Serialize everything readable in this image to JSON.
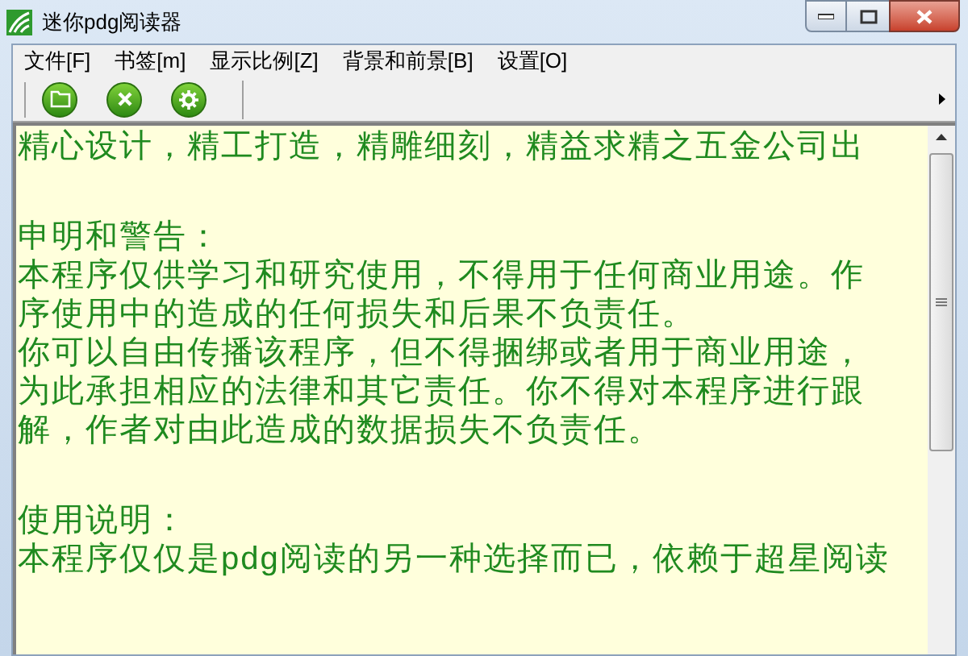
{
  "window": {
    "title": "迷你pdg阅读器"
  },
  "menu": [
    "文件[F]",
    "书签[m]",
    "显示比例[Z]",
    "背景和前景[B]",
    "设置[O]"
  ],
  "document": {
    "blocks": [
      {
        "lines": [
          "精心设计，精工打造，精雕细刻，精益求精之五金公司出"
        ]
      },
      {
        "lines": [
          "申明和警告：",
          "本程序仅供学习和研究使用，不得用于任何商业用途。作",
          "序使用中的造成的任何损失和后果不负责任。",
          "你可以自由传播该程序，但不得捆绑或者用于商业用途，",
          "为此承担相应的法律和其它责任。你不得对本程序进行跟",
          "解，作者对由此造成的数据损失不负责任。"
        ]
      },
      {
        "lines": [
          "使用说明：",
          "本程序仅仅是pdg阅读的另一种选择而已，依赖于超星阅读"
        ]
      }
    ]
  }
}
